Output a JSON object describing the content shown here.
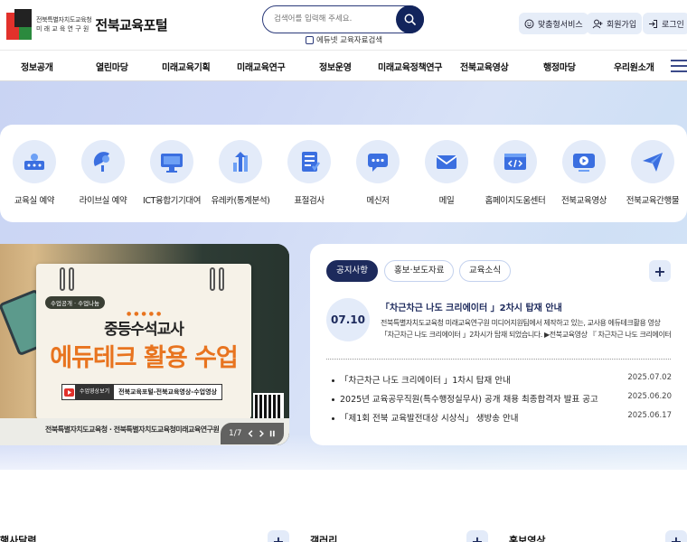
{
  "header": {
    "logo_line1": "전북특별자치도교육청",
    "logo_line2": "미래교육연구원",
    "logo_title": "전북교육포털",
    "search_placeholder": "검색어를 입력해 주세요.",
    "edunet_label": "에듀넷 교육자료검색",
    "util": [
      {
        "label": "맞춤형서비스",
        "icon": "smile-icon"
      },
      {
        "label": "회원가입",
        "icon": "user-add-icon"
      },
      {
        "label": "로그인",
        "icon": "login-icon"
      }
    ]
  },
  "nav": {
    "items": [
      "정보공개",
      "열린마당",
      "미래교육기획",
      "미래교육연구",
      "정보운영",
      "미래교육정책연구",
      "전북교육영상",
      "행정마당",
      "우리원소개"
    ]
  },
  "quick_menu": {
    "items": [
      {
        "label": "교육실 예약",
        "icon": "classroom-icon"
      },
      {
        "label": "라이브실 예약",
        "icon": "live-room-icon"
      },
      {
        "label": "ICT융합기기대여",
        "icon": "monitor-icon"
      },
      {
        "label": "유레카(통계분석)",
        "icon": "chart-icon"
      },
      {
        "label": "표절검사",
        "icon": "checklist-icon"
      },
      {
        "label": "메신저",
        "icon": "messenger-icon"
      },
      {
        "label": "메일",
        "icon": "mail-icon"
      },
      {
        "label": "홈페이지도움센터",
        "icon": "code-window-icon"
      },
      {
        "label": "전북교육영상",
        "icon": "video-icon"
      },
      {
        "label": "전북교육간행물",
        "icon": "paper-plane-icon"
      }
    ]
  },
  "banner": {
    "tag": "수업공개 · 수업나눔",
    "title1": "중등수석교사",
    "title2": "에듀테크 활용 수업",
    "foot_label": "수업영상보기",
    "foot_text": "전북교육포털-전북교육영상-수업영상",
    "bottom_text": "전북특별자치도교육청 · 전북특별자치도교육청미래교육연구원",
    "pager_text": "1/7"
  },
  "notice": {
    "tabs": [
      "공지사항",
      "홍보·보도자료",
      "교육소식"
    ],
    "featured": {
      "date": "07.10",
      "title": "「차근차근 나도 크리에이터 」2차시 탑재 안내",
      "desc": "전북특별자치도교육청 미래교육연구원 미디어지원팀에서 제작하고 있는, 교사용 에듀테크활용 영상 「차근차근 나도 크리에이터 」2차시가 탑재 되었습니다. ▶전북교육영상 『 차근차근 나도 크리에이터"
    },
    "list": [
      {
        "title": "「차근차근 나도 크리에이터 」1차시 탑재 안내",
        "date": "2025.07.02"
      },
      {
        "title": "2025년 교육공무직원(특수행정실무사) 공개 채용 최종합격자 발표 공고",
        "date": "2025.06.20"
      },
      {
        "title": "「제1회 전북 교육발전대상 시상식」 생방송 안내",
        "date": "2025.06.17"
      }
    ]
  },
  "sections": [
    "행사달력",
    "갤러리",
    "홍보영상"
  ]
}
